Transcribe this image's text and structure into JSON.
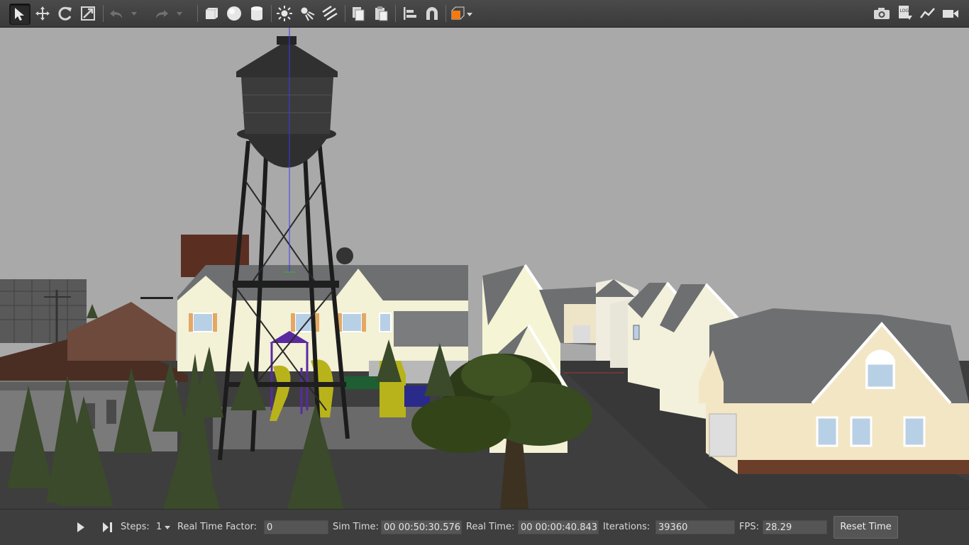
{
  "toolbar": {
    "left_tools": [
      {
        "name": "select-mode-icon",
        "active": true
      },
      {
        "name": "translate-mode-icon"
      },
      {
        "name": "rotate-mode-icon"
      },
      {
        "name": "scale-mode-icon"
      },
      {
        "name": "undo-icon"
      },
      {
        "name": "undo-history-chevron-icon"
      },
      {
        "name": "redo-icon"
      },
      {
        "name": "redo-history-chevron-icon"
      },
      {
        "name": "box-shape-icon"
      },
      {
        "name": "sphere-shape-icon"
      },
      {
        "name": "cylinder-shape-icon"
      },
      {
        "name": "point-light-icon"
      },
      {
        "name": "spot-light-icon"
      },
      {
        "name": "directional-light-icon"
      },
      {
        "name": "copy-icon"
      },
      {
        "name": "paste-icon"
      },
      {
        "name": "align-icon"
      },
      {
        "name": "snap-magnet-icon"
      },
      {
        "name": "view-angle-icon"
      }
    ],
    "right_tools": [
      {
        "name": "screenshot-camera-icon"
      },
      {
        "name": "log-icon",
        "label": "LOG"
      },
      {
        "name": "plot-icon"
      },
      {
        "name": "video-record-icon"
      }
    ]
  },
  "status": {
    "steps_label": "Steps:",
    "steps_value": "1",
    "rtf_label": "Real Time Factor:",
    "rtf_value": "0",
    "sim_time_label": "Sim Time:",
    "sim_time_value": "00 00:50:30.576",
    "real_time_label": "Real Time:",
    "real_time_value": "00 00:00:40.843",
    "iterations_label": "Iterations:",
    "iterations_value": "39360",
    "fps_label": "FPS:",
    "fps_value": "28.29",
    "reset_label": "Reset Time"
  },
  "colors": {
    "sky": "#a9a9a9",
    "ground": "#3d3d3d",
    "accent_orange": "#f47a10"
  }
}
